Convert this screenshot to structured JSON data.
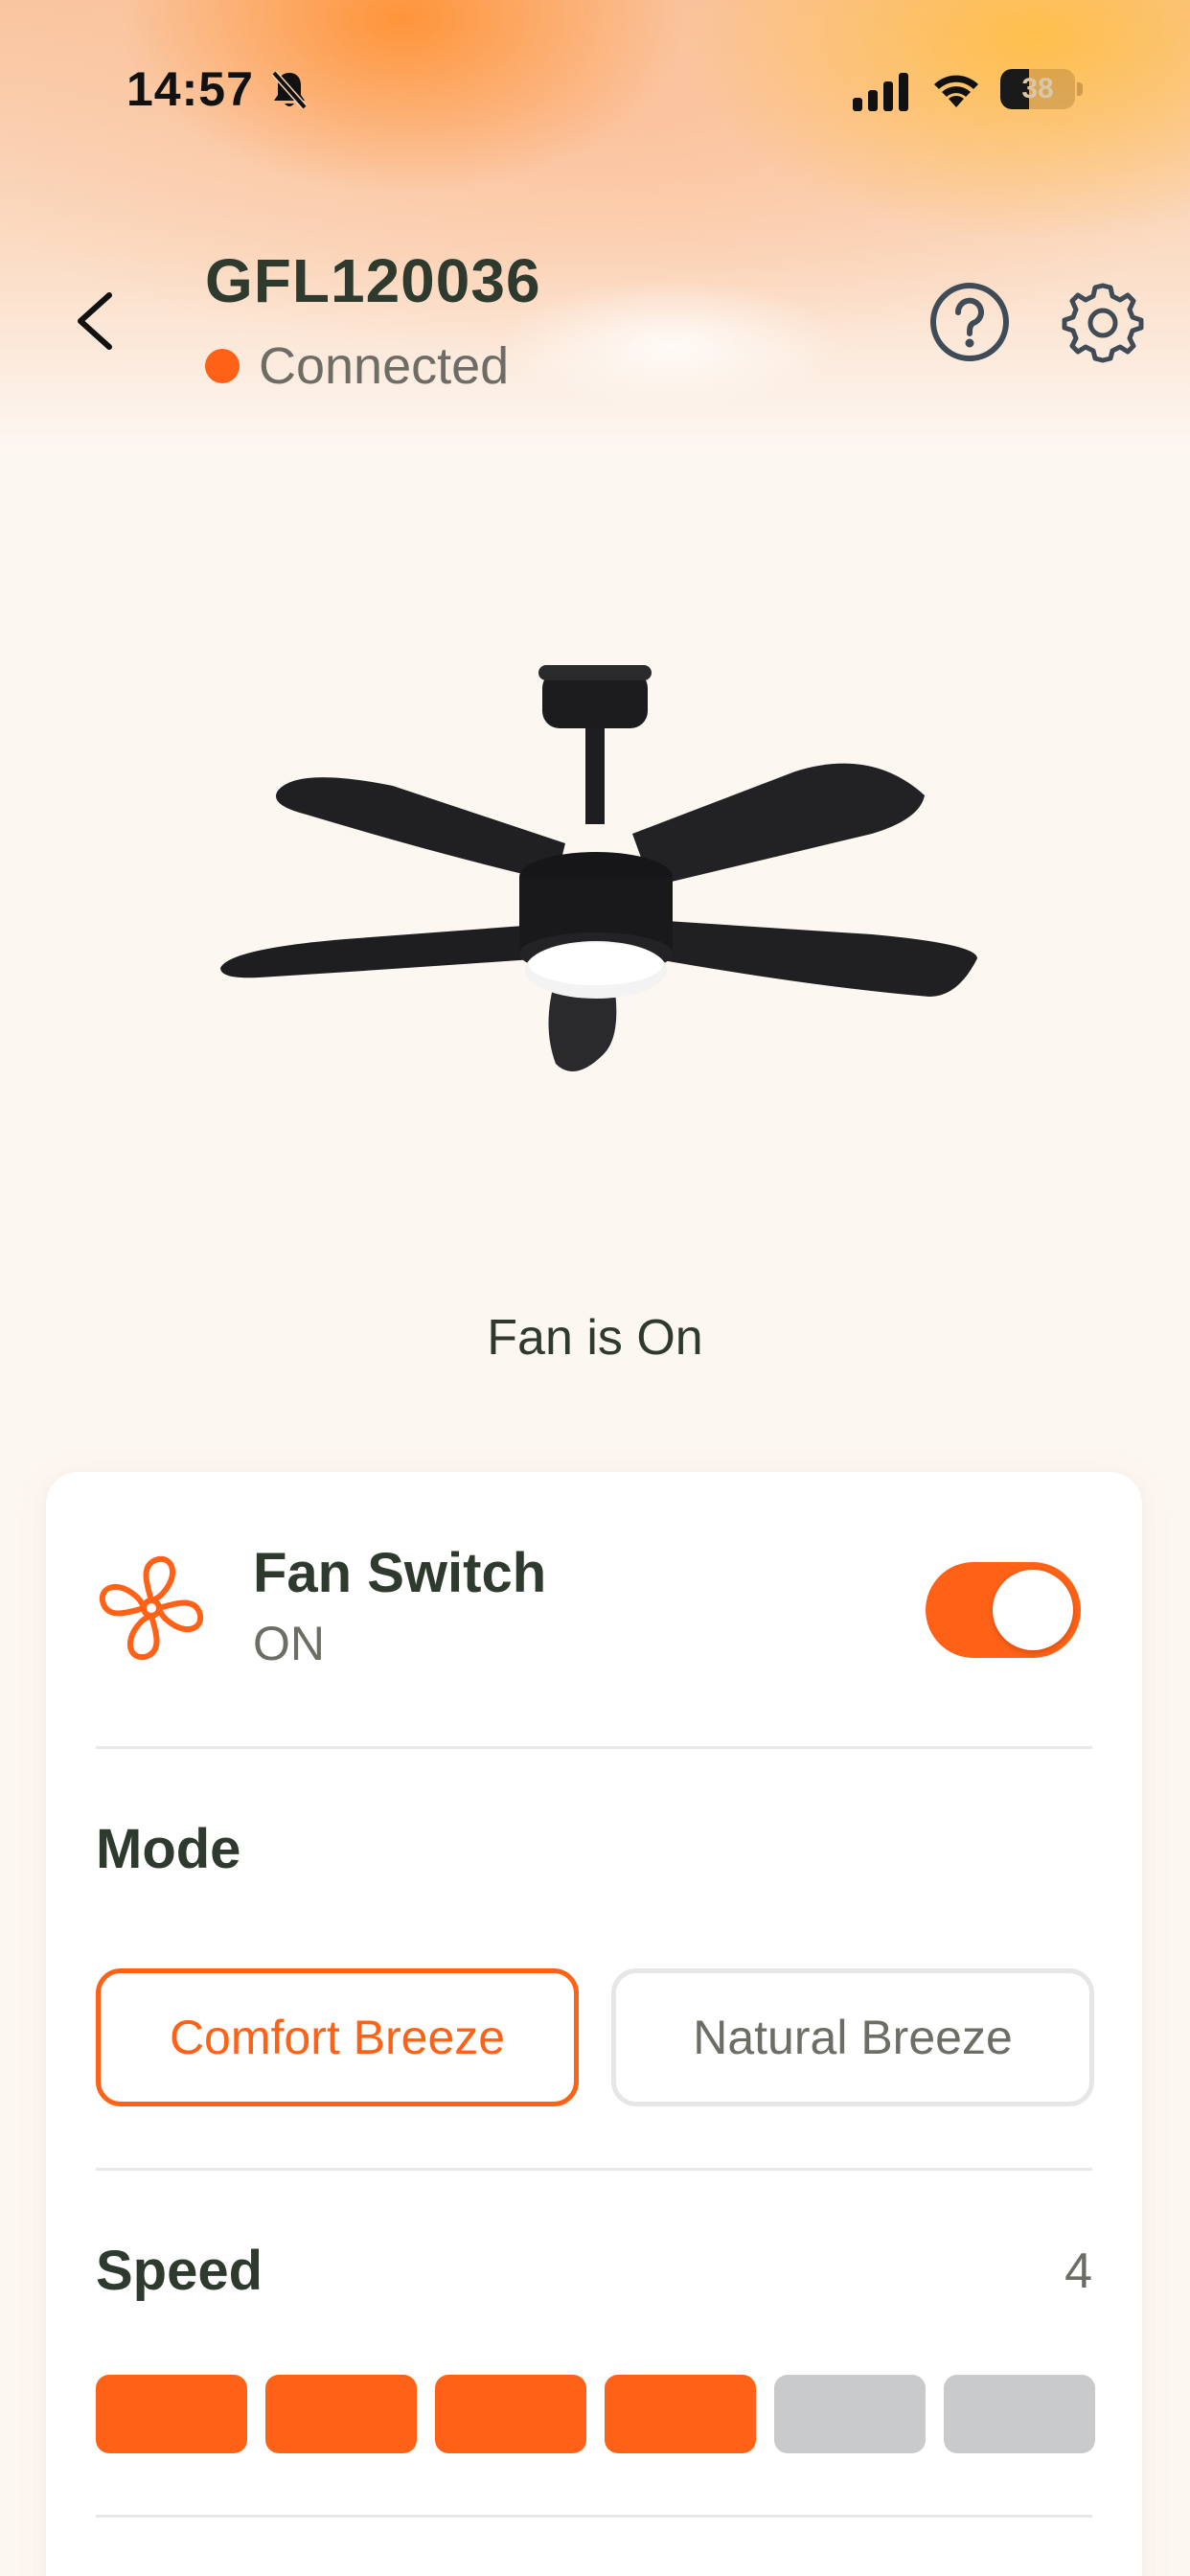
{
  "status_bar": {
    "time": "14:57",
    "battery_level": "38"
  },
  "header": {
    "device_name": "GFL120036",
    "connection_status": "Connected"
  },
  "fan_state": "Fan is On",
  "fan_switch": {
    "title": "Fan Switch",
    "state": "ON",
    "enabled": true
  },
  "mode": {
    "title": "Mode",
    "options": [
      "Comfort Breeze",
      "Natural Breeze"
    ],
    "selected": "Comfort Breeze"
  },
  "speed": {
    "title": "Speed",
    "value": "4",
    "level": 4,
    "max": 6
  },
  "colors": {
    "accent": "#ff6116",
    "inactive_segment": "#c8cacc",
    "text_primary": "#2f3a2f",
    "text_secondary": "#6d6d66"
  },
  "icons": {
    "back": "chevron-left-icon",
    "help": "question-circle-icon",
    "settings": "gear-icon",
    "fan": "fan-icon",
    "bell_off": "bell-off-icon"
  }
}
